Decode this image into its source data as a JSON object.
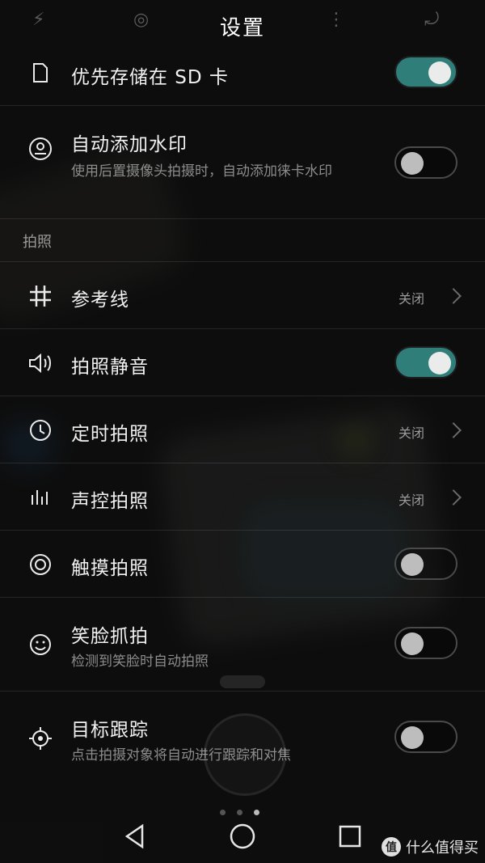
{
  "header": {
    "title": "设置"
  },
  "sd_row": {
    "label": "优先存储在 SD 卡",
    "enabled": true
  },
  "watermark_row": {
    "label": "自动添加水印",
    "description": "使用后置摄像头拍摄时，自动添加徕卡水印",
    "enabled": false
  },
  "section_photo": {
    "title": "拍照"
  },
  "items": [
    {
      "label": "参考线",
      "value": "关闭",
      "type": "link",
      "icon": "grid-icon"
    },
    {
      "label": "拍照静音",
      "type": "toggle",
      "enabled": true,
      "icon": "speaker-icon"
    },
    {
      "label": "定时拍照",
      "value": "关闭",
      "type": "link",
      "icon": "clock-icon"
    },
    {
      "label": "声控拍照",
      "value": "关闭",
      "type": "link",
      "icon": "audio-bars-icon"
    },
    {
      "label": "触摸拍照",
      "type": "toggle",
      "enabled": false,
      "icon": "target-circle-icon"
    },
    {
      "label": "笑脸抓拍",
      "description": "检测到笑脸时自动拍照",
      "type": "toggle",
      "enabled": false,
      "icon": "smile-icon"
    },
    {
      "label": "目标跟踪",
      "description": "点击拍摄对象将自动进行跟踪和对焦",
      "type": "toggle",
      "enabled": false,
      "icon": "crosshair-icon"
    }
  ],
  "pager": {
    "count": 3,
    "active": 3
  },
  "nav": {
    "back": "back-icon",
    "home": "home-icon",
    "recents": "recents-icon"
  },
  "brand": {
    "logo_text": "值",
    "text": "什么值得买"
  },
  "colors": {
    "accent": "#2f7e7a"
  }
}
